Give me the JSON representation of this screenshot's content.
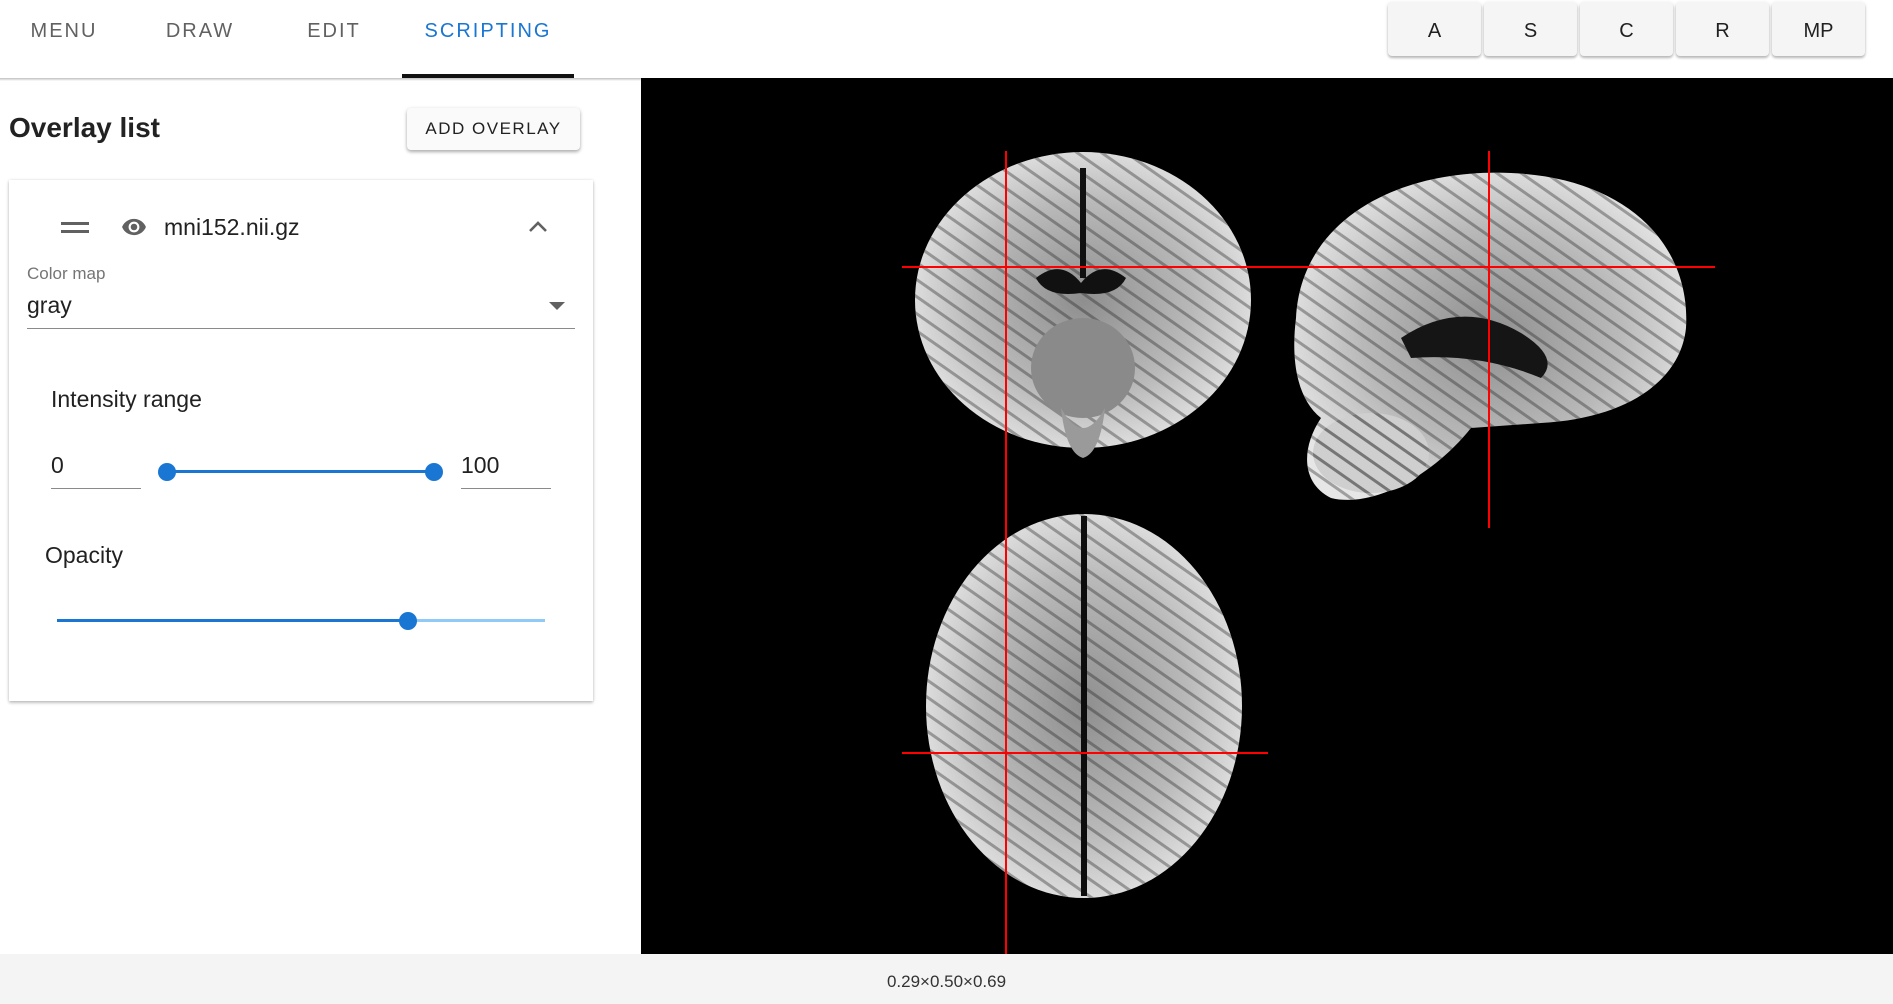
{
  "tabs": [
    {
      "label": "MENU",
      "active": false
    },
    {
      "label": "DRAW",
      "active": false
    },
    {
      "label": "EDIT",
      "active": false
    },
    {
      "label": "SCRIPTING",
      "active": true
    }
  ],
  "view_buttons": [
    "A",
    "S",
    "C",
    "R",
    "MP"
  ],
  "panel": {
    "title": "Overlay list",
    "add_button": "ADD OVERLAY"
  },
  "overlay": {
    "name": "mni152.nii.gz",
    "visible": true,
    "expanded": true,
    "colormap_label": "Color map",
    "colormap_value": "gray",
    "intensity_label": "Intensity range",
    "intensity_min": "0",
    "intensity_max": "100",
    "intensity_range_fraction": [
      0,
      1
    ],
    "opacity_label": "Opacity",
    "opacity_fraction": 0.72
  },
  "status": {
    "text": "0.29×0.50×0.69"
  },
  "colors": {
    "accent": "#1976d2",
    "accent_light": "#90caf9",
    "crosshair": "#ff0000",
    "viewer_background": "#000000"
  }
}
